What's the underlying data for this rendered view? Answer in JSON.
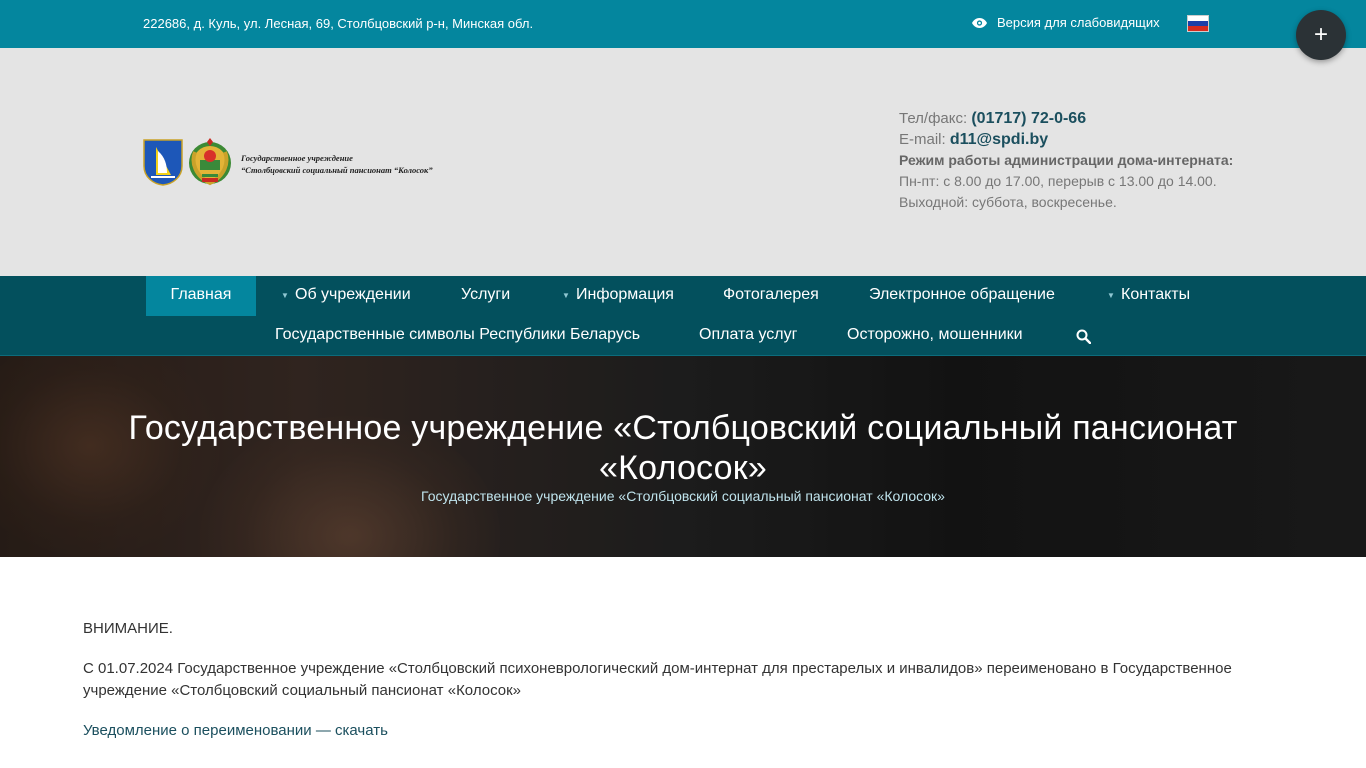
{
  "topbar": {
    "address": "222686, д. Куль, ул. Лесная, 69, Столбцовский р-н, Минская обл.",
    "vision_label": "Версия для слабовидящих",
    "vision_icon": "eye-icon",
    "language_flag": "russian-flag-icon",
    "plus_label": "+"
  },
  "header": {
    "logo_text_line1": "Государственное учреждение",
    "logo_text_line2": "“Столбцовский социальный пансионат “Колосок”",
    "phone_label": "Тел/факс:",
    "phone_value": "(01717) 72-0-66",
    "email_label": "E-mail:",
    "email_value": "d11@spdi.by",
    "schedule_title": "Режим работы администрации дома-интерната:",
    "schedule_weekdays": "Пн-пт: с 8.00 до 17.00, перерыв с 13.00 до 14.00.",
    "schedule_weekend": "Выходной: суббота, воскресенье."
  },
  "nav": {
    "row1": [
      {
        "label": "Главная"
      },
      {
        "label": "Об учреждении"
      },
      {
        "label": "Услуги"
      },
      {
        "label": "Информация"
      },
      {
        "label": "Фотогалерея"
      },
      {
        "label": "Электронное обращение"
      },
      {
        "label": "Контакты"
      }
    ],
    "row2": [
      {
        "label": "Государственные символы Республики Беларусь"
      },
      {
        "label": "Оплата услуг"
      },
      {
        "label": "Осторожно, мошенники"
      }
    ],
    "search_icon": "search-icon"
  },
  "hero": {
    "title": "Государственное учреждение «Столбцовский социальный пансионат «Колосок»",
    "breadcrumb": "Государственное учреждение «Столбцовский социальный пансионат «Колосок»"
  },
  "content": {
    "attention": "ВНИМАНИЕ.",
    "paragraph": "С 01.07.2024 Государственное учреждение «Столбцовский психоневрологический дом-интернат для престарелых и инвалидов» переименовано в Государственное учреждение «Столбцовский социальный пансионат «Колосок»",
    "notice_link": "Уведомление о переименовании — скачать"
  },
  "colors": {
    "topbar": "#04869e",
    "header_bg": "#e4e4e4",
    "nav_bg": "#03505d",
    "nav_active": "#04869e",
    "link": "#1b4f5e"
  }
}
